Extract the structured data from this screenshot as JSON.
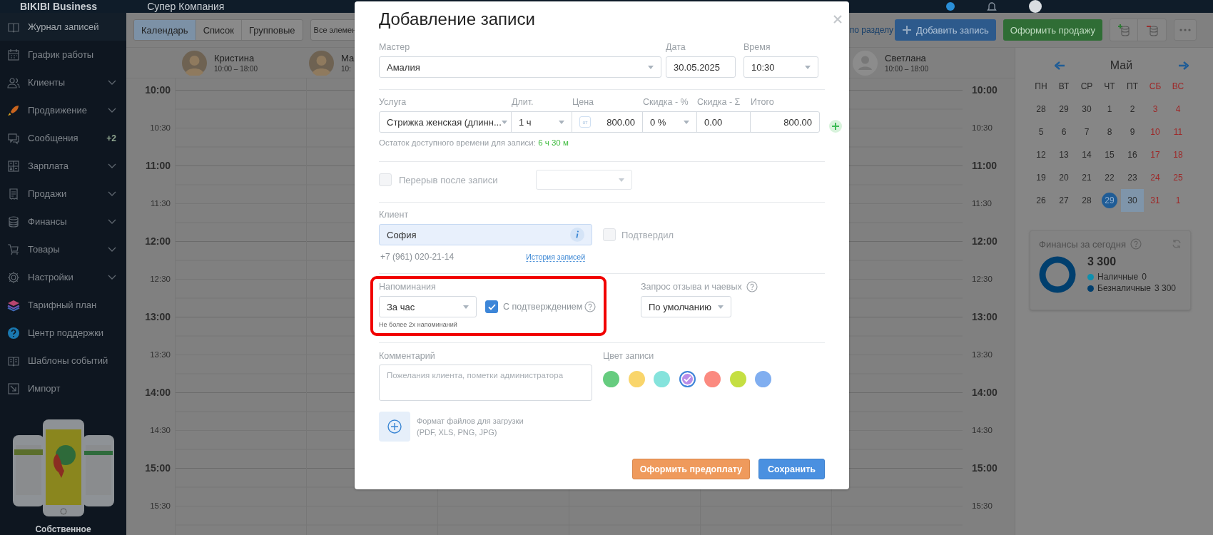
{
  "top_bar": {
    "brand": "BIKIBI Business",
    "company": "Супер Компания"
  },
  "sidebar": {
    "items": [
      {
        "label": "Журнал записей",
        "selected": true,
        "expandable": false
      },
      {
        "label": "График работы",
        "selected": false,
        "expandable": false
      },
      {
        "label": "Клиенты",
        "selected": false,
        "expandable": true
      },
      {
        "label": "Продвижение",
        "selected": false,
        "expandable": true
      },
      {
        "label": "Сообщения",
        "selected": false,
        "expandable": false,
        "badge": "+2"
      },
      {
        "label": "Зарплата",
        "selected": false,
        "expandable": true
      },
      {
        "label": "Продажи",
        "selected": false,
        "expandable": true
      },
      {
        "label": "Финансы",
        "selected": false,
        "expandable": true
      },
      {
        "label": "Товары",
        "selected": false,
        "expandable": true
      },
      {
        "label": "Настройки",
        "selected": false,
        "expandable": true
      },
      {
        "label": "Тарифный план",
        "selected": false,
        "expandable": false
      },
      {
        "label": "Центр поддержки",
        "selected": false,
        "expandable": false
      },
      {
        "label": "Шаблоны событий",
        "selected": false,
        "expandable": false
      },
      {
        "label": "Импорт",
        "selected": false,
        "expandable": false
      }
    ],
    "promo": {
      "caption": "Собственное"
    }
  },
  "toolbar": {
    "view_tabs": [
      {
        "label": "Календарь",
        "selected": true
      },
      {
        "label": "Список",
        "selected": false
      },
      {
        "label": "Групповые",
        "selected": false
      }
    ],
    "filter": "Все элемен",
    "section_link": "по разделу",
    "add_button": "Добавить запись",
    "sale_button": "Оформить продажу"
  },
  "schedule": {
    "staff": [
      {
        "name": "Кристина",
        "hours": "10:00 – 18:00",
        "kind": "photo"
      },
      {
        "name": "Ма",
        "hours": "10:",
        "kind": "photo"
      },
      {
        "name": "Светлана",
        "hours": "10:00 – 18:00",
        "kind": "placeholder"
      }
    ],
    "time_labels_left": [
      {
        "label": "10:00",
        "kind": "hour"
      },
      {
        "label": "10:30",
        "kind": "half"
      },
      {
        "label": "11:00",
        "kind": "hour"
      },
      {
        "label": "11:30",
        "kind": "half"
      },
      {
        "label": "12:00",
        "kind": "hour"
      },
      {
        "label": "12:30",
        "kind": "half"
      },
      {
        "label": "13:00",
        "kind": "hour"
      },
      {
        "label": "13:30",
        "kind": "half"
      },
      {
        "label": "14:00",
        "kind": "hour"
      },
      {
        "label": "14:30",
        "kind": "half"
      },
      {
        "label": "15:00",
        "kind": "hour"
      },
      {
        "label": "15:30",
        "kind": "half"
      }
    ],
    "time_labels_right": [
      {
        "label": "10:00",
        "kind": "hour"
      },
      {
        "label": "10:30",
        "kind": "half"
      },
      {
        "label": "11:00",
        "kind": "hour"
      },
      {
        "label": "11:30",
        "kind": "half"
      },
      {
        "label": "12:00",
        "kind": "hour"
      },
      {
        "label": "12:30",
        "kind": "half"
      },
      {
        "label": "13:00",
        "kind": "hour"
      },
      {
        "label": "13:30",
        "kind": "half"
      },
      {
        "label": "14:00",
        "kind": "hour"
      },
      {
        "label": "14:30",
        "kind": "half"
      },
      {
        "label": "15:00",
        "kind": "hour"
      },
      {
        "label": "15:30",
        "kind": "half"
      }
    ]
  },
  "mini_calendar": {
    "month": "Май",
    "weekdays": [
      {
        "label": "ПН",
        "weekend": false
      },
      {
        "label": "ВТ",
        "weekend": false
      },
      {
        "label": "СР",
        "weekend": false
      },
      {
        "label": "ЧТ",
        "weekend": false
      },
      {
        "label": "ПТ",
        "weekend": false
      },
      {
        "label": "СБ",
        "weekend": true
      },
      {
        "label": "ВС",
        "weekend": true
      }
    ],
    "weeks": [
      [
        {
          "day": "28",
          "today": false,
          "selected": false
        },
        {
          "day": "29",
          "today": false,
          "selected": false
        },
        {
          "day": "30",
          "today": false,
          "selected": false
        },
        {
          "day": "1",
          "today": false,
          "selected": false
        },
        {
          "day": "2",
          "today": false,
          "selected": false
        },
        {
          "day": "3",
          "today": false,
          "selected": false
        },
        {
          "day": "4",
          "today": false,
          "selected": false
        }
      ],
      [
        {
          "day": "5",
          "today": false,
          "selected": false
        },
        {
          "day": "6",
          "today": false,
          "selected": false
        },
        {
          "day": "7",
          "today": false,
          "selected": false
        },
        {
          "day": "8",
          "today": false,
          "selected": false
        },
        {
          "day": "9",
          "today": false,
          "selected": false
        },
        {
          "day": "10",
          "today": false,
          "selected": false
        },
        {
          "day": "11",
          "today": false,
          "selected": false
        }
      ],
      [
        {
          "day": "12",
          "today": false,
          "selected": false
        },
        {
          "day": "13",
          "today": false,
          "selected": false
        },
        {
          "day": "14",
          "today": false,
          "selected": false
        },
        {
          "day": "15",
          "today": false,
          "selected": false
        },
        {
          "day": "16",
          "today": false,
          "selected": false
        },
        {
          "day": "17",
          "today": false,
          "selected": false
        },
        {
          "day": "18",
          "today": false,
          "selected": false
        }
      ],
      [
        {
          "day": "19",
          "today": false,
          "selected": false
        },
        {
          "day": "20",
          "today": false,
          "selected": false
        },
        {
          "day": "21",
          "today": false,
          "selected": false
        },
        {
          "day": "22",
          "today": false,
          "selected": false
        },
        {
          "day": "23",
          "today": false,
          "selected": false
        },
        {
          "day": "24",
          "today": false,
          "selected": false
        },
        {
          "day": "25",
          "today": false,
          "selected": false
        }
      ],
      [
        {
          "day": "26",
          "today": false,
          "selected": false
        },
        {
          "day": "27",
          "today": false,
          "selected": false
        },
        {
          "day": "28",
          "today": false,
          "selected": false
        },
        {
          "day": "29",
          "today": true,
          "selected": false
        },
        {
          "day": "30",
          "today": false,
          "selected": true
        },
        {
          "day": "31",
          "today": false,
          "selected": false
        },
        {
          "day": "1",
          "today": false,
          "selected": false
        }
      ]
    ]
  },
  "finance": {
    "title": "Финансы за сегодня",
    "total": "3 300",
    "legend": [
      {
        "label": "Наличные",
        "value": "0",
        "color": "#0e8fae"
      },
      {
        "label": "Безналичные",
        "value": "3 300",
        "color": "#003f6e"
      }
    ]
  },
  "modal": {
    "title": "Добавление записи",
    "master": {
      "label": "Мастер",
      "value": "Амалия"
    },
    "date": {
      "label": "Дата",
      "value": "30.05.2025"
    },
    "time": {
      "label": "Время",
      "value": "10:30"
    },
    "service_columns": [
      "Услуга",
      "Длит.",
      "Цена",
      "Скидка - %",
      "Скидка - Σ",
      "Итого"
    ],
    "service": {
      "name": "Стрижка женская (длинн...",
      "duration": "1 ч",
      "price_prefix": "от",
      "price": "800.00",
      "discount_pct": "0 %",
      "discount_sum": "0.00",
      "total": "800.00"
    },
    "remaining": {
      "label": "Остаток доступного времени для записи:",
      "value": "6 ч 30 м"
    },
    "break": {
      "label": "Перерыв после записи",
      "checked": false
    },
    "client": {
      "label": "Клиент",
      "value": "София",
      "phone": "+7 (961) 020-21-14",
      "history_link": "История записей",
      "confirmed_label": "Подтвердил",
      "confirmed": false
    },
    "reminders": {
      "label": "Напоминания",
      "value": "За час",
      "confirmation_label": "С подтверждением",
      "confirmation": true,
      "note": "Не более 2х напоминаний",
      "highlighted": true
    },
    "review": {
      "label": "Запрос отзыва и чаевых",
      "value": "По умолчанию"
    },
    "comment": {
      "label": "Комментарий",
      "placeholder": "Пожелания клиента, пометки администратора"
    },
    "colors": {
      "label": "Цвет записи",
      "options": [
        {
          "color": "#66cc7f",
          "selected": false
        },
        {
          "color": "#f9d56b",
          "selected": false
        },
        {
          "color": "#85e3dc",
          "selected": false
        },
        {
          "color": "#b98de8",
          "selected": true
        },
        {
          "color": "#fb8a80",
          "selected": false
        },
        {
          "color": "#c5df42",
          "selected": false
        },
        {
          "color": "#80aef0",
          "selected": false
        }
      ]
    },
    "upload": {
      "hint_lines": [
        "Формат файлов для загрузки",
        "(PDF, XLS, PNG, JPG)"
      ]
    },
    "buttons": [
      {
        "label": "Оформить предоплату",
        "kind": "prepay"
      },
      {
        "label": "Сохранить",
        "kind": "primary"
      }
    ]
  }
}
